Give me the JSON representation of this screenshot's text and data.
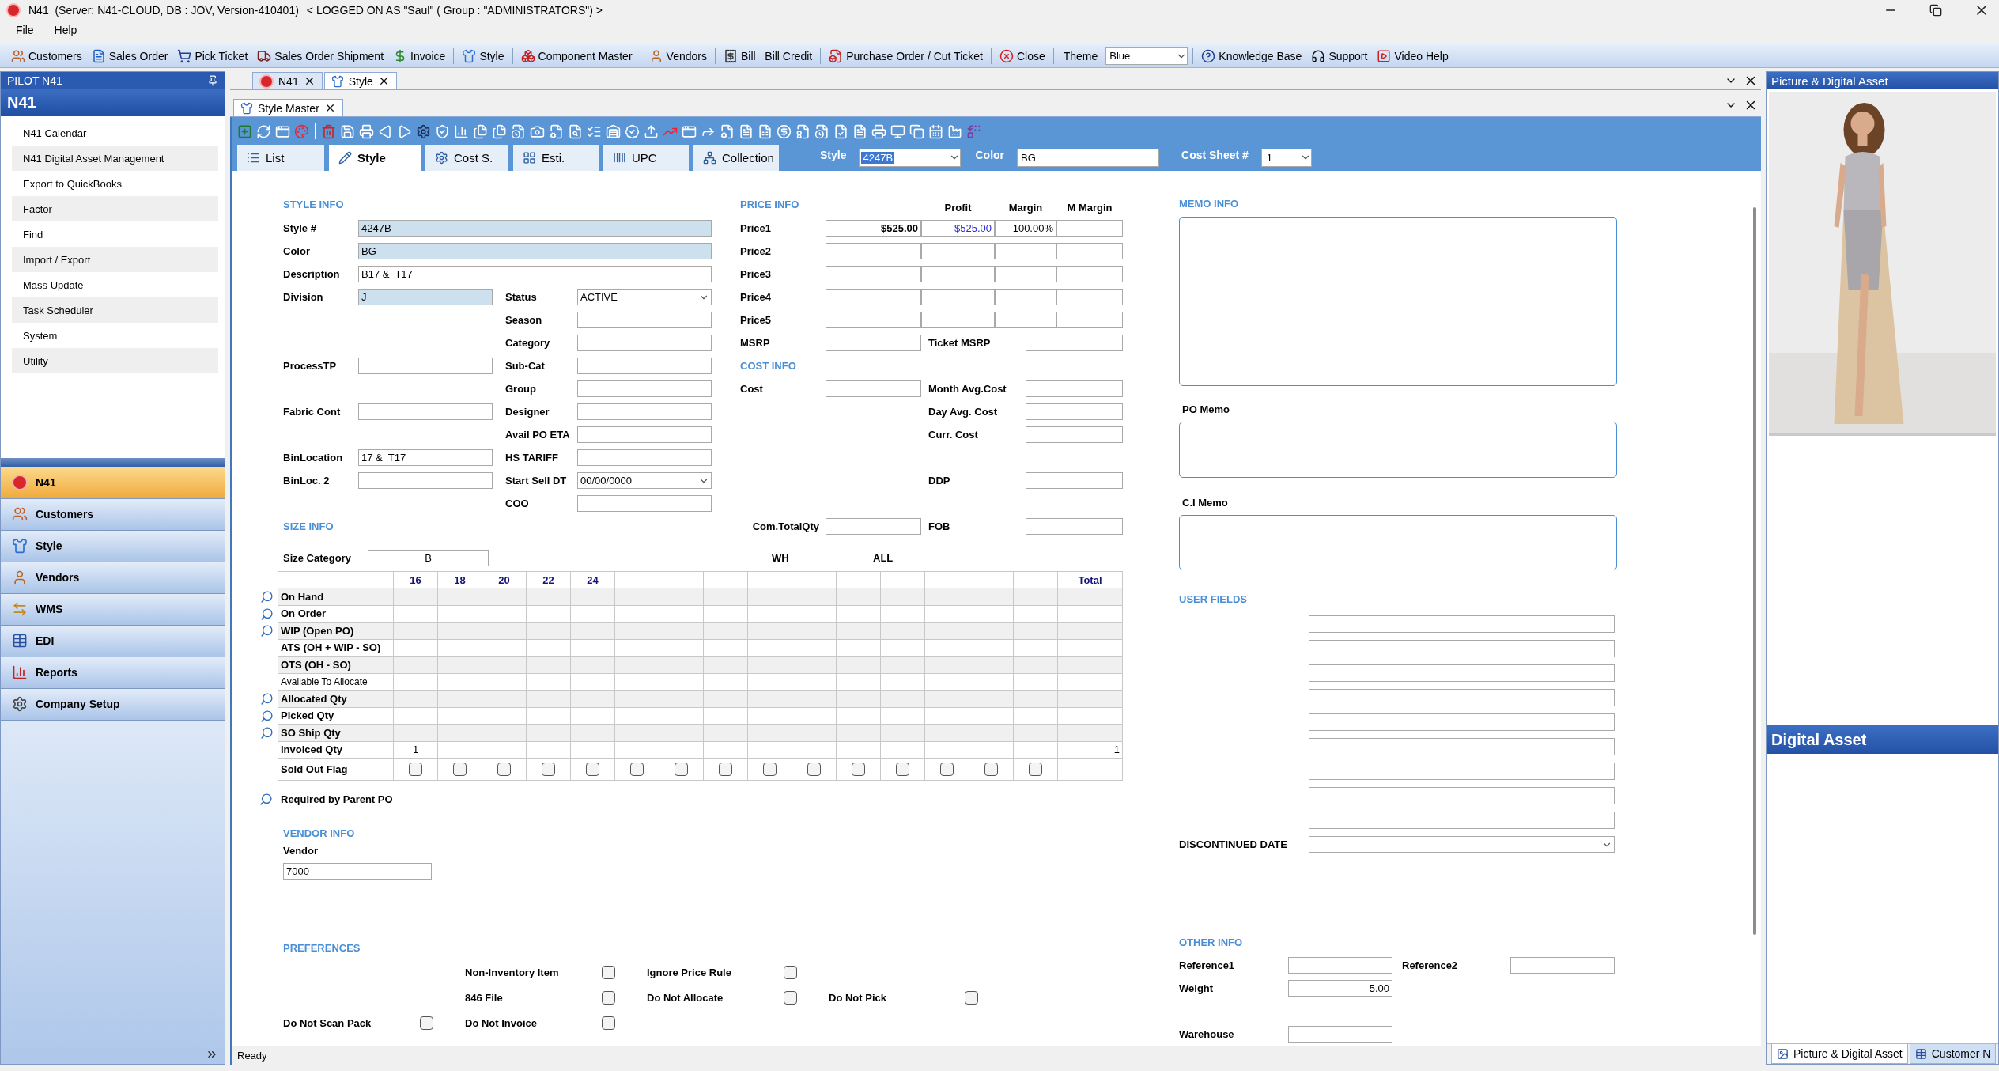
{
  "window": {
    "title": "N41  (Server: N41-CLOUD, DB : JOV, Version-410401)",
    "login": "< LOGGED ON AS \"Saul\" ( Group : \"ADMINISTRATORS\") >"
  },
  "menu": [
    "File",
    "Help"
  ],
  "toolbar": {
    "items": [
      "Customers",
      "Sales Order",
      "Pick Ticket",
      "Sales Order Shipment",
      "Invoice",
      "Style",
      "Component Master",
      "Vendors",
      "Bill _Bill Credit",
      "Purchase Order / Cut Ticket",
      "Close"
    ],
    "theme_label": "Theme",
    "theme": "Blue",
    "help_items": [
      "Knowledge Base",
      "Support",
      "Video Help"
    ]
  },
  "pilot": {
    "title": "PILOT N41",
    "heading": "N41",
    "items": [
      "N41 Calendar",
      "N41 Digital Asset Management",
      "Export to QuickBooks",
      "Factor",
      "Find",
      "Import / Export",
      "Mass Update",
      "Task Scheduler",
      "System",
      "Utility"
    ],
    "nav": [
      {
        "label": "N41",
        "selected": true
      },
      {
        "label": "Customers",
        "selected": false
      },
      {
        "label": "Style",
        "selected": false
      },
      {
        "label": "Vendors",
        "selected": false
      },
      {
        "label": "WMS",
        "selected": false
      },
      {
        "label": "EDI",
        "selected": false
      },
      {
        "label": "Reports",
        "selected": false
      },
      {
        "label": "Company Setup",
        "selected": false
      }
    ]
  },
  "doc_tabs": [
    {
      "label": "N41",
      "selected": false
    },
    {
      "label": "Style",
      "selected": true
    }
  ],
  "sub_tabs": [
    {
      "label": "Style Master",
      "selected": true
    }
  ],
  "form_tabs": [
    {
      "label": "List",
      "selected": false
    },
    {
      "label": "Style",
      "selected": true
    },
    {
      "label": "Cost S.",
      "selected": false
    },
    {
      "label": "Esti.",
      "selected": false
    },
    {
      "label": "UPC",
      "selected": false
    },
    {
      "label": "Collection",
      "selected": false
    }
  ],
  "lookup": {
    "style_label": "Style",
    "style": "4247B",
    "color_label": "Color",
    "color_field": "BG",
    "cost_sheet_label": "Cost Sheet #",
    "cost_sheet": "1"
  },
  "style_info": {
    "title": "STYLE INFO",
    "rows": [
      {
        "full": {
          "label": "Style #",
          "value": "4247B",
          "kind": "text",
          "shaded": true
        }
      },
      {
        "full": {
          "label": "Color",
          "value": "BG",
          "kind": "text",
          "shaded": true
        }
      },
      {
        "full": {
          "label": "Description",
          "value": "B17 &  T17",
          "kind": "text",
          "shaded": false
        }
      },
      {
        "left": {
          "label": "Division",
          "value": "J",
          "kind": "text",
          "shaded": true
        },
        "right": {
          "label": "Status",
          "value": "ACTIVE",
          "kind": "dropdown",
          "shaded": false
        }
      },
      {
        "right": {
          "label": "Season",
          "kind": "text",
          "shaded": false
        }
      },
      {
        "right": {
          "label": "Category",
          "kind": "text",
          "shaded": false
        }
      },
      {
        "left": {
          "label": "ProcessTP",
          "kind": "text",
          "shaded": false
        },
        "right": {
          "label": "Sub-Cat",
          "kind": "text",
          "shaded": false
        }
      },
      {
        "right": {
          "label": "Group",
          "kind": "text",
          "shaded": false
        }
      },
      {
        "left": {
          "label": "Fabric Cont",
          "kind": "text",
          "shaded": false
        },
        "right": {
          "label": "Designer",
          "kind": "text",
          "shaded": false
        }
      },
      {
        "right": {
          "label": "Avail PO ETA",
          "kind": "text",
          "shaded": false
        }
      },
      {
        "left": {
          "label": "BinLocation",
          "value": "17 &  T17",
          "kind": "text",
          "shaded": false
        },
        "right": {
          "label": "HS TARIFF",
          "kind": "text",
          "shaded": false
        }
      },
      {
        "left": {
          "label": "BinLoc. 2",
          "kind": "text",
          "shaded": false
        },
        "right": {
          "label": "Start Sell DT",
          "value": "00/00/0000",
          "kind": "dropdown",
          "shaded": false
        }
      },
      {
        "right": {
          "label": "COO",
          "kind": "text",
          "shaded": false
        }
      }
    ]
  },
  "price_info": {
    "title": "PRICE INFO",
    "columns": [
      "Profit",
      "Margin",
      "M Margin"
    ],
    "rows": [
      {
        "kind": "price",
        "label": "Price1",
        "values": [
          "$525.00",
          "$525.00",
          "100.00%"
        ]
      },
      {
        "kind": "price",
        "label": "Price2"
      },
      {
        "kind": "price",
        "label": "Price3"
      },
      {
        "kind": "price",
        "label": "Price4"
      },
      {
        "kind": "price",
        "label": "Price5"
      },
      {
        "kind": "pair",
        "label": "MSRP",
        "label2": "Ticket MSRP"
      },
      {
        "kind": "heading",
        "label": "COST INFO"
      },
      {
        "kind": "pair",
        "label": "Cost",
        "label2": "Month Avg.Cost"
      },
      {
        "kind": "right",
        "label2": "Day Avg. Cost"
      },
      {
        "kind": "right",
        "label2": "Curr. Cost"
      },
      {
        "kind": "blank"
      },
      {
        "kind": "right",
        "label2": "DDP"
      },
      {
        "kind": "blank"
      },
      {
        "kind": "total",
        "label": "Com.TotalQty",
        "label2": "FOB"
      }
    ]
  },
  "size_info": {
    "title": "SIZE INFO",
    "category_label": "Size Category",
    "category": "B",
    "wh": "WH",
    "all": "ALL",
    "sizes": [
      "16",
      "18",
      "20",
      "22",
      "24"
    ],
    "total_label": "Total",
    "parent_po": "Required by Parent PO",
    "rows": [
      {
        "label": "On Hand",
        "kind": "values",
        "lookup": true
      },
      {
        "label": "On Order",
        "kind": "values",
        "lookup": true
      },
      {
        "label": "WIP (Open PO)",
        "kind": "values",
        "lookup": true
      },
      {
        "label": "ATS (OH + WIP - SO)",
        "kind": "values",
        "lookup": false
      },
      {
        "label": "OTS (OH - SO)",
        "kind": "values",
        "lookup": false
      },
      {
        "label": "Available To Allocate",
        "kind": "values",
        "lookup": false
      },
      {
        "label": "Allocated Qty",
        "kind": "values",
        "lookup": true
      },
      {
        "label": "Picked Qty",
        "kind": "values",
        "lookup": true
      },
      {
        "label": "SO Ship Qty",
        "kind": "values",
        "lookup": true
      },
      {
        "label": "Invoiced Qty",
        "kind": "values",
        "lookup": false,
        "cells": [
          "1"
        ],
        "total": "1"
      },
      {
        "label": "Sold Out Flag",
        "kind": "flags",
        "lookup": false,
        "flags": [
          false,
          false,
          false,
          false,
          false,
          false,
          false,
          false,
          false,
          false,
          false,
          false,
          false,
          false,
          false
        ]
      }
    ]
  },
  "vendor_info": {
    "title": "VENDOR INFO",
    "label": "Vendor",
    "value": "7000"
  },
  "preferences": {
    "title": "PREFERENCES",
    "rows": [
      [
        null,
        {
          "label": "Non-Inventory Item",
          "checked": false
        },
        {
          "label": "Ignore Price Rule",
          "checked": false
        },
        null
      ],
      [
        null,
        {
          "label": "846 File",
          "checked": false
        },
        {
          "label": "Do Not Allocate",
          "checked": false
        },
        {
          "label": "Do Not Pick",
          "checked": false
        }
      ],
      [
        {
          "label": "Do Not Scan Pack",
          "checked": false
        },
        {
          "label": "Do Not Invoice",
          "checked": false
        },
        null,
        null
      ]
    ]
  },
  "memo": {
    "title": "MEMO INFO",
    "po_label": "PO Memo",
    "ci_label": "C.I Memo"
  },
  "user_fields": {
    "title": "USER FIELDS",
    "discontinued_label": "DISCONTINUED DATE"
  },
  "other_info": {
    "title": "OTHER INFO",
    "reference1": "Reference1",
    "reference2": "Reference2",
    "weight_label": "Weight",
    "weight": "5.00",
    "warehouse_label": "Warehouse"
  },
  "status_bar": "Ready",
  "right_panel": {
    "title": "Picture & Digital Asset",
    "asset_title": "Digital Asset",
    "tabs": [
      {
        "label": "Picture & Digital Asset",
        "selected": true
      },
      {
        "label": "Customer N",
        "selected": false
      }
    ]
  }
}
